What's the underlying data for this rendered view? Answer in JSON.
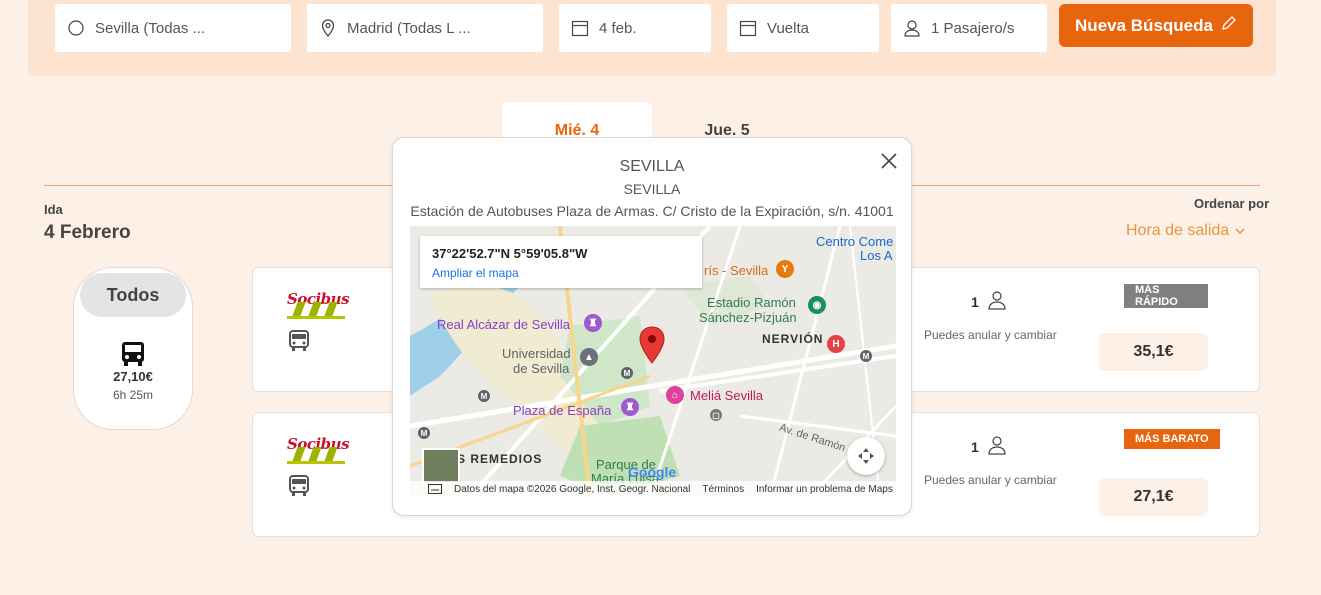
{
  "search": {
    "origin": "Sevilla (Todas ...",
    "destination": "Madrid (Todas L ...",
    "date": "4 feb.",
    "return": "Vuelta",
    "passengers": "1 Pasajero/s",
    "button": "Nueva Búsqueda"
  },
  "days": [
    {
      "label": "Mié. 4"
    },
    {
      "label": "Jue. 5"
    }
  ],
  "section": {
    "direction": "Ida",
    "date": "4 Febrero",
    "sort_label": "Ordenar por",
    "sort_value": "Hora de salida"
  },
  "filter": {
    "all": "Todos",
    "price": "27,10€",
    "duration": "6h 25m"
  },
  "trips": [
    {
      "company": "Socibus",
      "passengers": "1",
      "cancel": "Puedes anular y cambiar",
      "badge": "MÁS RÁPIDO",
      "price": "35,1€"
    },
    {
      "company": "Socibus",
      "passengers": "1",
      "cancel": "Puedes anular y cambiar",
      "badge": "MÁS BARATO",
      "price": "27,1€"
    }
  ],
  "modal": {
    "title": "SEVILLA",
    "subtitle": "SEVILLA",
    "address": "Estación de Autobuses Plaza de Armas. C/ Cristo de la Expiración, s/n. 41001",
    "coords": "37°22'52.7\"N 5°59'05.8\"W",
    "enlarge": "Ampliar el mapa",
    "pois": {
      "centro": "Centro Come",
      "los": "Los A",
      "paris": "rís - Sevilla",
      "estadio1": "Estadio Ramón",
      "estadio2": "Sánchez-Pizjuán",
      "alcazar": "Real Alcázar de Sevilla",
      "universidad1": "Universidad",
      "universidad2": "de Sevilla",
      "nervion": "NERVIÓN",
      "melia": "Meliá Sevilla",
      "plaza": "Plaza de España",
      "remedios": "S REMEDIOS",
      "parque1": "Parque de",
      "parque2": "María Luisa",
      "avramon": "Av. de Ramón",
      "google": "Google"
    },
    "footer": {
      "data": "Datos del mapa ©2026 Google, Inst. Geogr. Nacional",
      "terms": "Términos",
      "report": "Informar un problema de Maps"
    }
  },
  "colors": {
    "accent": "#e8650f",
    "background": "#fdf0e6",
    "search_bg": "#fde4d0",
    "fast_badge": "#808080"
  }
}
